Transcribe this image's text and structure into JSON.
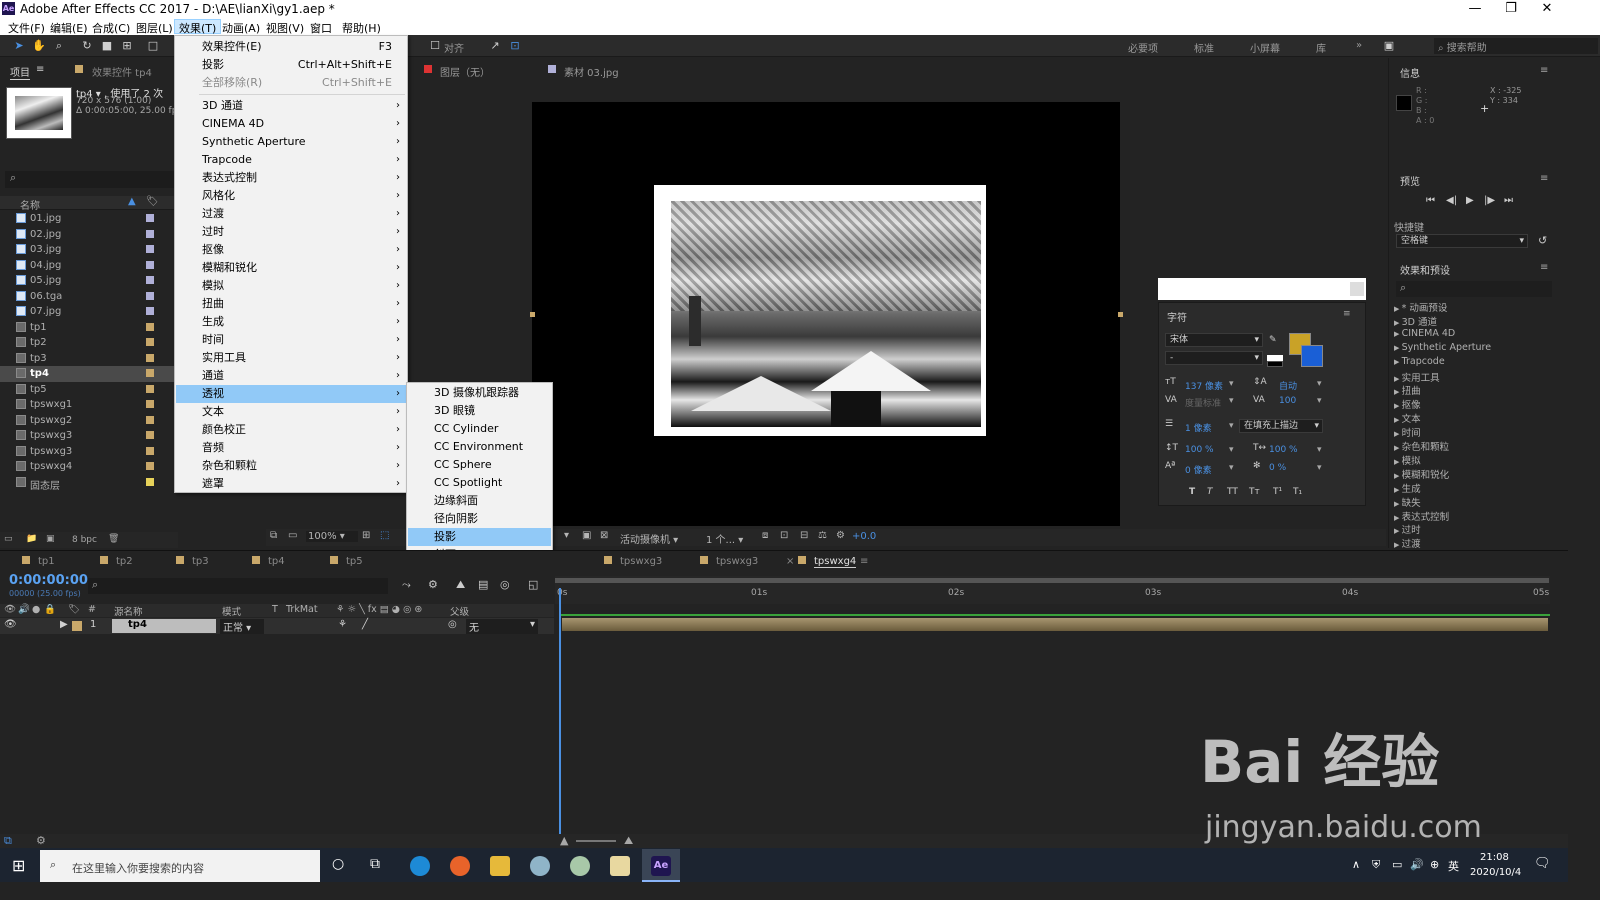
{
  "window": {
    "title": "Adobe After Effects CC 2017 - D:\\AE\\lianXi\\gy1.aep *",
    "logo": "Ae"
  },
  "menubar": [
    "文件(F)",
    "编辑(E)",
    "合成(C)",
    "图层(L)",
    "效果(T)",
    "动画(A)",
    "视图(V)",
    "窗口",
    "帮助(H)"
  ],
  "toolbar": {
    "snap": "对齐",
    "workspaces": [
      "必要项",
      "标准",
      "小屏幕",
      "库"
    ],
    "help_placeholder": "搜索帮助"
  },
  "project": {
    "tab": "项目",
    "tab2": "效果控件 tp4",
    "thumb_name": "tp4 ▾ , 使用了 2 次",
    "thumb_info1": "720 x 576 (1.00)",
    "thumb_info2": "Δ 0:00:05:00, 25.00 fps",
    "col_name": "名称",
    "files": [
      "01.jpg",
      "02.jpg",
      "03.jpg",
      "04.jpg",
      "05.jpg",
      "06.tga",
      "07.jpg",
      "tp1",
      "tp2",
      "tp3",
      "tp4",
      "tp5",
      "tpswxg1",
      "tpswxg2",
      "tpswxg3",
      "tpswxg3",
      "tpswxg4",
      "固态层"
    ],
    "bpc": "8 bpc"
  },
  "effects_menu": {
    "items": [
      {
        "label": "效果控件(E)",
        "shortcut": "F3"
      },
      {
        "label": "投影",
        "shortcut": "Ctrl+Alt+Shift+E"
      },
      {
        "label": "全部移除(R)",
        "shortcut": "Ctrl+Shift+E"
      },
      {
        "label": "3D 通道"
      },
      {
        "label": "CINEMA 4D"
      },
      {
        "label": "Synthetic Aperture"
      },
      {
        "label": "Trapcode"
      },
      {
        "label": "表达式控制"
      },
      {
        "label": "风格化"
      },
      {
        "label": "过渡"
      },
      {
        "label": "过时"
      },
      {
        "label": "抠像"
      },
      {
        "label": "模糊和锐化"
      },
      {
        "label": "模拟"
      },
      {
        "label": "扭曲"
      },
      {
        "label": "生成"
      },
      {
        "label": "时间"
      },
      {
        "label": "实用工具"
      },
      {
        "label": "通道"
      },
      {
        "label": "透视"
      },
      {
        "label": "文本"
      },
      {
        "label": "颜色校正"
      },
      {
        "label": "音频"
      },
      {
        "label": "杂色和颗粒"
      },
      {
        "label": "遮罩"
      }
    ]
  },
  "perspective_submenu": [
    "3D 摄像机跟踪器",
    "3D 眼镜",
    "CC Cylinder",
    "CC Environment",
    "CC Sphere",
    "CC Spotlight",
    "边缘斜面",
    "径向阴影",
    "投影",
    "斜面 Alpha"
  ],
  "comp": {
    "layer_tab": "图层（无）",
    "footage_tab": "素材 03.jpg",
    "zoom": "100%",
    "camera": "活动摄像机",
    "views": "1 个...",
    "exposure": "+0.0"
  },
  "info": {
    "title": "信息",
    "r": "R :",
    "g": "G :",
    "b": "B :",
    "a": "A : 0",
    "x": "X : -325",
    "y": "Y : 334"
  },
  "preview": {
    "title": "预览",
    "shortcut_label": "快捷键",
    "shortcut_value": "空格键"
  },
  "effects_presets": {
    "title": "效果和预设",
    "items": [
      "* 动画预设",
      "3D 通道",
      "CINEMA 4D",
      "Synthetic Aperture",
      "Trapcode",
      "实用工具",
      "扭曲",
      "抠像",
      "文本",
      "时间",
      "杂色和颗粒",
      "模拟",
      "模糊和锐化",
      "生成",
      "缺失",
      "表达式控制",
      "过时",
      "过渡"
    ]
  },
  "character": {
    "title": "字符",
    "font": "宋体",
    "style": "-",
    "size": "137 像素",
    "leading": "自动",
    "kerning": "度量标准",
    "tracking": "100",
    "stroke": "1 像素",
    "stroke_mode": "在填充上描边",
    "vscale": "100 %",
    "hscale": "100 %",
    "baseline": "0 像素",
    "tsume": "0 %",
    "fill_color": "#c9a227",
    "stroke_color": "#1a5fd6"
  },
  "timeline": {
    "tabs": [
      "tp1",
      "tp2",
      "tp3",
      "tp4",
      "tp5",
      "tpswxg3",
      "tpswxg3",
      "tpswxg4"
    ],
    "timecode": "0:00:00:00",
    "fps": "00000 (25.00 fps)",
    "col_source": "源名称",
    "col_mode": "模式",
    "col_t": "T",
    "col_trkmat": "TrkMat",
    "col_parent": "父级",
    "layer_num": "1",
    "layer_name": "tp4",
    "layer_mode": "正常",
    "layer_parent": "无",
    "ruler": [
      "0s",
      "01s",
      "02s",
      "03s",
      "04s",
      "05s"
    ]
  },
  "taskbar": {
    "search": "在这里输入你要搜索的内容",
    "time": "21:08",
    "date": "2020/10/4",
    "ime": "英"
  },
  "watermark": {
    "text": "Bai 经验",
    "url": "jingyan.baidu.com"
  }
}
